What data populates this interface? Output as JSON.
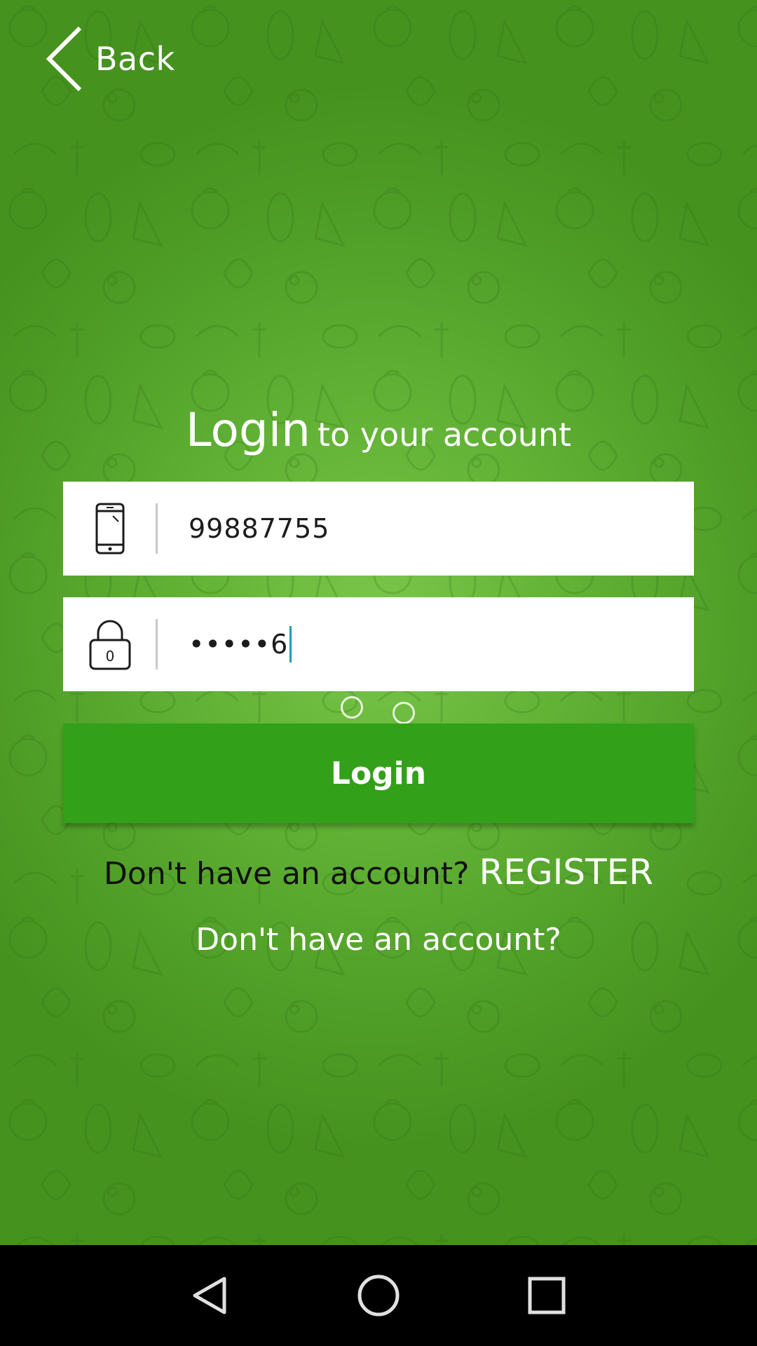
{
  "header": {
    "back_label": "Back"
  },
  "login": {
    "title_main": "Login",
    "title_sub": "to your account",
    "phone": {
      "value": "99887755",
      "icon": "smartphone-icon"
    },
    "password": {
      "masked_value": "•••••6",
      "icon": "lock-icon"
    },
    "button_label": "Login",
    "register_prompt": "Don't have an account?",
    "register_link": "REGISTER",
    "secondary_prompt": "Don't have an account?"
  },
  "colors": {
    "background_green": "#5eaf33",
    "button_green": "#33a01a",
    "text_white": "#ffffff",
    "caret_teal": "#1a9fb8"
  },
  "system_nav": {
    "back": "nav-back-icon",
    "home": "nav-home-icon",
    "recents": "nav-recents-icon"
  }
}
